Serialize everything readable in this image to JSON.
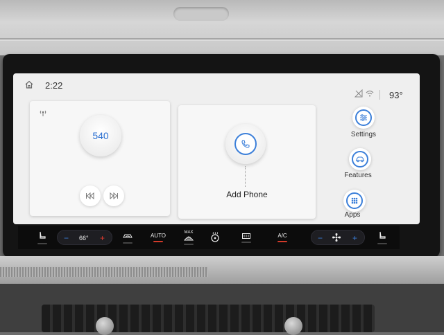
{
  "status": {
    "time": "2:22",
    "temperature": "93°",
    "icons": [
      "home-icon",
      "no-signal-icon",
      "wifi-icon"
    ]
  },
  "media": {
    "station": "540",
    "icons": [
      "radio-icon",
      "seek-back-icon",
      "seek-forward-icon"
    ]
  },
  "phone": {
    "label": "Add Phone",
    "icon": "phone-icon"
  },
  "side_menu": {
    "settings_label": "Settings",
    "features_label": "Features",
    "apps_label": "Apps"
  },
  "climate": {
    "driver_temp": "66°",
    "auto_label": "AUTO",
    "max_label": "MAX",
    "ac_label": "A/C",
    "icons": [
      "heated-seat-icon",
      "recirculation-icon",
      "max-defrost-icon",
      "steering-heat-icon",
      "rear-defrost-icon",
      "fan-icon",
      "passenger-seat-icon"
    ]
  },
  "colors": {
    "accent_blue": "#3b7fd9",
    "indicator_red": "#d23a2a",
    "screen_bg": "#efefef",
    "climate_bg": "#0c0c0c"
  }
}
